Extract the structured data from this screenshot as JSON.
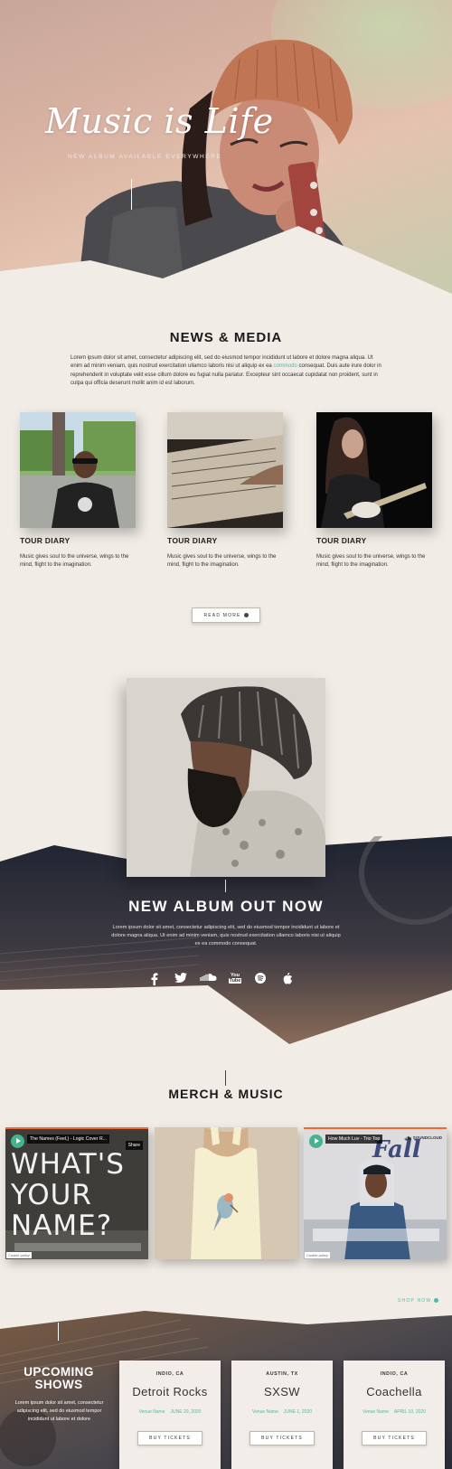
{
  "hero": {
    "title": "Music is Life",
    "subtitle": "NEW ALBUM AVAILABLE EVERYWHERE"
  },
  "news": {
    "title": "NEWS & MEDIA",
    "lorem_a": "Lorem ipsum dolor sit amet, consectetur adipiscing elit, sed do eiusmod tempor incididunt ut labore et dolore magna aliqua. Ut enim ad minim veniam, quis nostrud exercitation ullamco laboris nisi ut aliquip ex ea ",
    "lorem_link": "commodo",
    "lorem_b": " consequat. Duis aute irure dolor in reprehenderit in voluptate velit esse cillum dolore eu fugiat nulla pariatur. Excepteur sint occaecat cupidatat non proident, sunt in culpa qui officia deserunt mollit anim id est laborum.",
    "cards": [
      {
        "title": "TOUR DIARY",
        "text": "Music gives soul to the universe, wings to the mind, flight to the imagination."
      },
      {
        "title": "TOUR DIARY",
        "text": "Music gives soul to the universe, wings to the mind, flight to the imagination."
      },
      {
        "title": "TOUR DIARY",
        "text": "Music gives soul to the universe, wings to the mind, flight to the imagination."
      }
    ],
    "read_more": "READ MORE"
  },
  "album": {
    "title": "NEW ALBUM OUT NOW",
    "text": "Lorem ipsum dolor sit amet, consectetur adipiscing elit, sed do eiusmod tempor incididunt ut labore et dolore magna aliqua. Ut enim ad minim veniam, quis nostrud exercitation ullamco laboris nisi ut aliquip ex ea commodo consequat.",
    "socials": [
      {
        "icon": "facebook-icon",
        "label": "f"
      },
      {
        "icon": "twitter-icon",
        "label": "t"
      },
      {
        "icon": "soundcloud-icon",
        "label": "sc"
      },
      {
        "icon": "youtube-icon",
        "label": "You Tube"
      },
      {
        "icon": "spotify-icon",
        "label": "sp"
      },
      {
        "icon": "apple-icon",
        "label": "ap"
      }
    ]
  },
  "merch": {
    "title": "MERCH & MUSIC",
    "player1": {
      "track": "The Names (Feel,) - Logic Cover R...",
      "share": "Share",
      "art_text": [
        "WHAT'S",
        "YOUR",
        "NAME?"
      ],
      "cookie": "Cookie policy"
    },
    "player2": {
      "track": "How Much Luv - Trio Top",
      "brand": "SOUNDCLOUD",
      "art_text": "Fall",
      "cookie": "Cookie policy"
    },
    "shop_now": "SHOP NOW"
  },
  "shows": {
    "title": "UPCOMING SHOWS",
    "text": "Lorem ipsum dolor sit amet, consectetur adipiscing elit, sed do eiusmod tempor incididunt ut labore et dolore",
    "items": [
      {
        "location": "INDIO, CA",
        "name": "Detroit Rocks",
        "venue": "Venue Name",
        "date": "JUNE 20, 2020",
        "button": "BUY TICKETS"
      },
      {
        "location": "AUSTIN, TX",
        "name": "SXSW",
        "venue": "Venue Name",
        "date": "JUNE 1, 2020",
        "button": "BUY TICKETS"
      },
      {
        "location": "INDIO, CA",
        "name": "Coachella",
        "venue": "Venue Name",
        "date": "APRIL 10, 2020",
        "button": "BUY TICKETS"
      }
    ]
  },
  "colors": {
    "accent": "#4fb8a8",
    "background": "#f1ece6",
    "soundcloud": "#f06a2f",
    "play": "#43b48b"
  }
}
